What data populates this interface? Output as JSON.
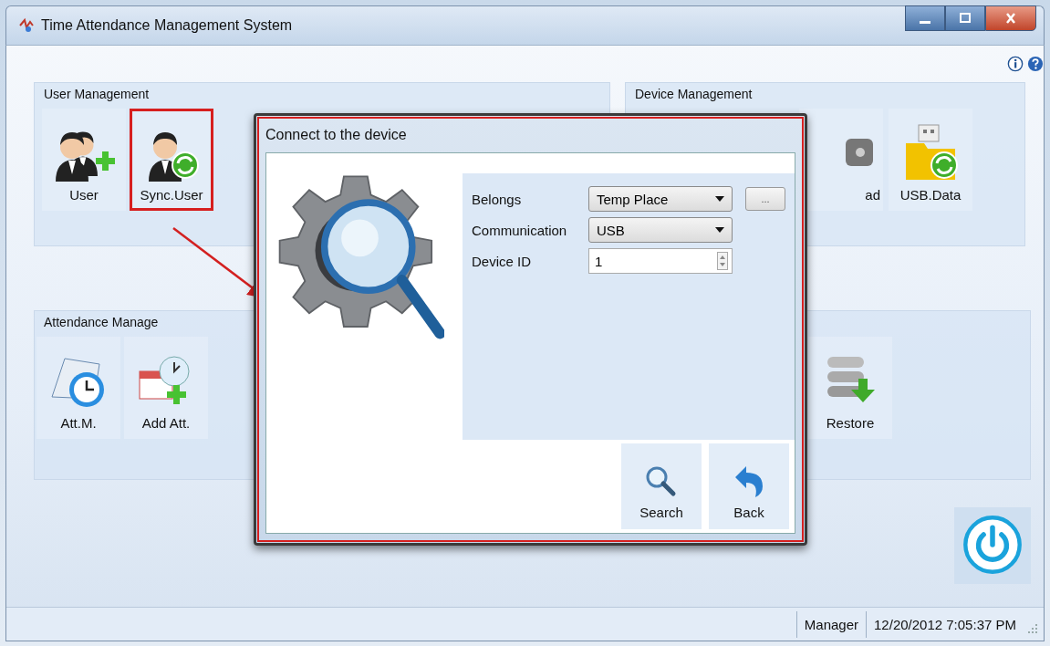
{
  "window": {
    "title": "Time Attendance Management System"
  },
  "user_management": {
    "title": "User Management",
    "tools": [
      {
        "label": "User",
        "kind": "user-add",
        "highlighted": false
      },
      {
        "label": "Sync.User",
        "kind": "user-sync",
        "highlighted": true
      }
    ]
  },
  "device_management": {
    "title": "Device Management",
    "tools": [
      {
        "label": "ad",
        "kind": "download",
        "highlighted": false
      },
      {
        "label": "USB.Data",
        "kind": "usb",
        "highlighted": false
      }
    ]
  },
  "attendance_manage": {
    "title": "Attendance Manage",
    "tools": [
      {
        "label": "Att.M.",
        "kind": "calendar-clock",
        "highlighted": false
      },
      {
        "label": "Add Att.",
        "kind": "calendar-add",
        "highlighted": false
      },
      {
        "label": "Restore",
        "kind": "restore",
        "highlighted": false
      }
    ]
  },
  "dialog": {
    "title": "Connect to the device",
    "fields": [
      {
        "kind": "select",
        "label": "Belongs",
        "value": "Temp Place",
        "browse": "..."
      },
      {
        "kind": "select",
        "label": "Communication",
        "value": "USB"
      },
      {
        "kind": "spin",
        "label": "Device ID",
        "value": "1"
      }
    ],
    "buttons": [
      {
        "kind": "search",
        "label": "Search"
      },
      {
        "kind": "back",
        "label": "Back"
      }
    ]
  },
  "status_bar": {
    "user": "Manager",
    "datetime": "12/20/2012 7:05:37 PM"
  }
}
